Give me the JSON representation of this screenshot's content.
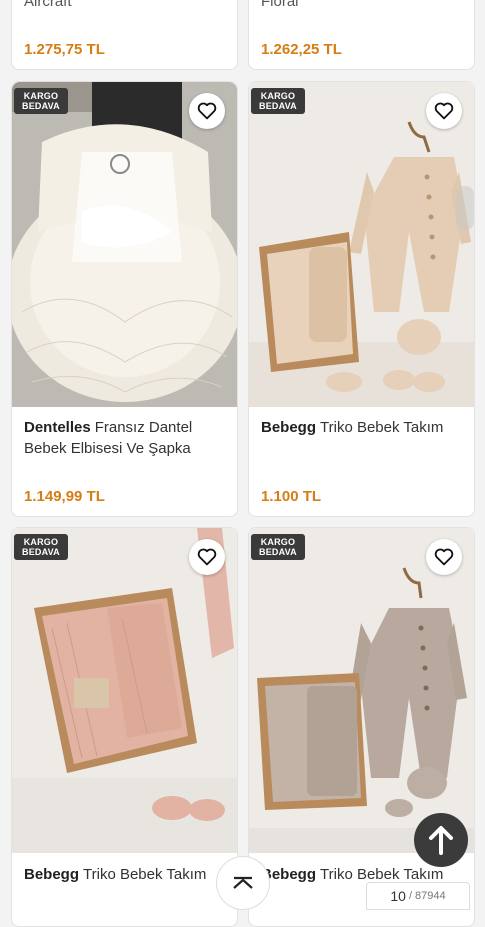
{
  "top_row": {
    "left_title_fragment": "Aircraft",
    "left_price": "1.275,75 TL",
    "right_title_fragment": "Floral",
    "right_price": "1.262,25 TL"
  },
  "products": [
    {
      "badge_line1": "KARGO",
      "badge_line2": "BEDAVA",
      "brand": "Dentelles",
      "name": "Fransız Dantel Bebek Elbisesi Ve Şapka",
      "price": "1.149,99 TL"
    },
    {
      "badge_line1": "KARGO",
      "badge_line2": "BEDAVA",
      "brand": "Bebegg",
      "name": "Triko Bebek Takım",
      "price": "1.100 TL"
    },
    {
      "badge_line1": "KARGO",
      "badge_line2": "BEDAVA",
      "brand": "Bebegg",
      "name": "Triko Bebek Takım",
      "price": ""
    },
    {
      "badge_line1": "KARGO",
      "badge_line2": "BEDAVA",
      "brand": "Bebegg",
      "name": "Triko Bebek Takım",
      "price": ""
    }
  ],
  "pager": {
    "current": "10",
    "total": "/ 87944"
  },
  "icons": {
    "favorite": "heart-outline-icon",
    "scroll_top": "arrow-up-icon",
    "collapse": "chevron-up-icon"
  },
  "colors": {
    "price": "#d67d14",
    "badge": "#3a3a3a"
  }
}
